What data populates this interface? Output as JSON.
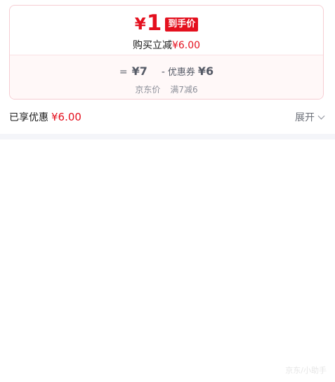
{
  "price_card": {
    "currency": "¥",
    "final_price": "1",
    "final_price_tag": "到手价",
    "instant_cut_label": "购买立减",
    "instant_cut_amount": "¥6.00",
    "calc": {
      "equals": "=",
      "original_price": "¥7",
      "minus": "-",
      "coupon_label": "优惠券",
      "coupon_amount": "¥6"
    },
    "sub": {
      "original_caption": "京东价",
      "coupon_caption": "满7减6"
    }
  },
  "discount_row": {
    "label": "已享优惠",
    "amount": "¥6.00",
    "expand_label": "展开"
  },
  "watermark": "京东/小助手",
  "colors": {
    "accent_red": "#e4101e",
    "card_border": "#f6cdd3",
    "card_bottom_bg": "#fff8f8",
    "band": "#f4f5f9"
  },
  "icons": {
    "expand": "chevron-down-icon"
  }
}
